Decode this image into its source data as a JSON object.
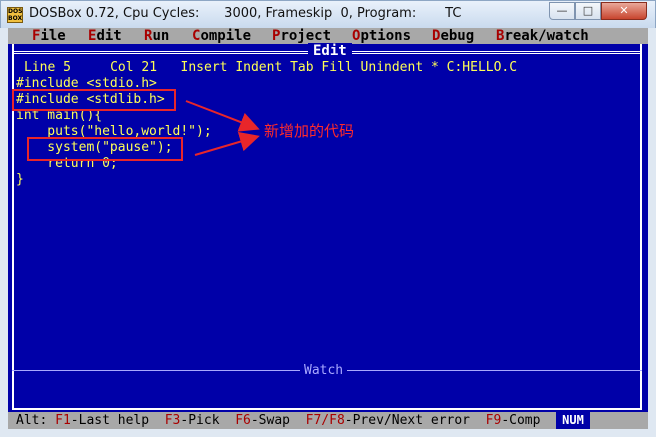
{
  "window": {
    "title": "DOSBox 0.72, Cpu Cycles:      3000, Frameskip  0, Program:       TC",
    "icon_text": "DOS BOX",
    "controls": {
      "minimize": "—",
      "maximize": "□",
      "close": "✕"
    }
  },
  "menu": [
    {
      "hk": "F",
      "rest": "ile"
    },
    {
      "hk": "E",
      "rest": "dit"
    },
    {
      "hk": "R",
      "rest": "un"
    },
    {
      "hk": "C",
      "rest": "ompile"
    },
    {
      "hk": "P",
      "rest": "roject"
    },
    {
      "hk": "O",
      "rest": "ptions"
    },
    {
      "hk": "D",
      "rest": "ebug"
    },
    {
      "hk": "B",
      "rest": "reak/watch"
    }
  ],
  "editor": {
    "title": "Edit",
    "status": "Line 5     Col 21   Insert Indent Tab Fill Unindent * C:HELLO.C",
    "code": [
      "#include <stdio.h>",
      "#include <stdlib.h>",
      "int main(){",
      "    puts(\"hello,world!\");",
      "    system(\"pause\");",
      "    return 0;",
      "}"
    ],
    "watch_title": "Watch"
  },
  "bottom": {
    "prefix": "Alt: ",
    "keys": [
      {
        "hk": "F1",
        "label": "-Last help"
      },
      {
        "hk": "F3",
        "label": "-Pick"
      },
      {
        "hk": "F6",
        "label": "-Swap"
      },
      {
        "hk": "F7/F8",
        "label": "-Prev/Next error"
      },
      {
        "hk": "F9",
        "label": "-Comp"
      }
    ],
    "num": "NUM"
  },
  "annotation": "新增加的代码",
  "colors": {
    "screen_bg": "#0000a8",
    "text": "#ffff55",
    "menu_bg": "#a8a8a8",
    "hotkey": "#a80000",
    "annotation": "#e8262a"
  }
}
